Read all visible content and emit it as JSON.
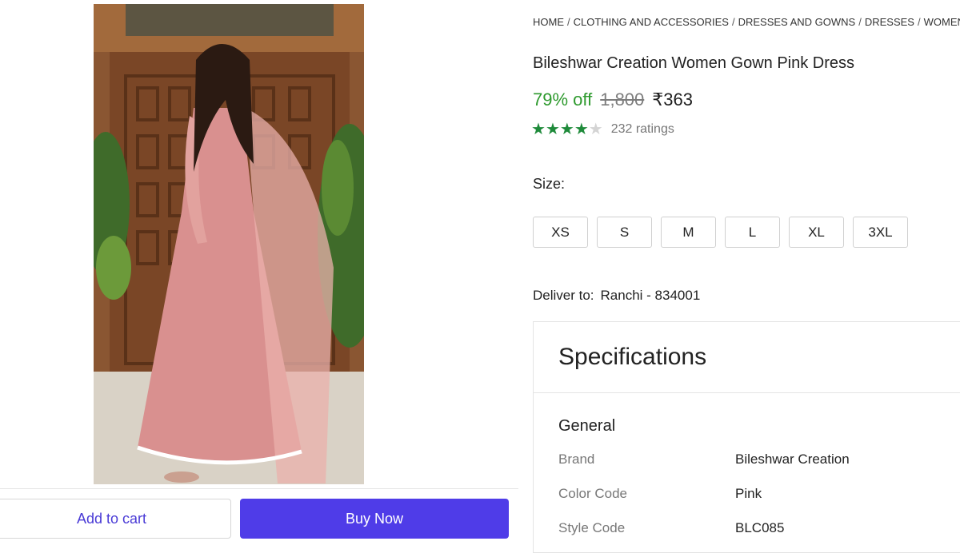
{
  "breadcrumb": [
    "HOME",
    "CLOTHING AND ACCESSORIES",
    "DRESSES AND GOWNS",
    "DRESSES",
    "WOMEN'S DR"
  ],
  "product": {
    "title": "Bileshwar Creation Women Gown Pink Dress",
    "discount": "79% off",
    "mrp": "1,800",
    "price": "₹363",
    "rating_value": 4,
    "rating_max": 5,
    "ratings_text": "232 ratings"
  },
  "size": {
    "label": "Size:",
    "options": [
      "XS",
      "S",
      "M",
      "L",
      "XL",
      "3XL"
    ]
  },
  "delivery": {
    "label": "Deliver to:",
    "location": "Ranchi - 834001"
  },
  "specifications": {
    "title": "Specifications",
    "section": "General",
    "rows": [
      {
        "key": "Brand",
        "value": "Bileshwar Creation"
      },
      {
        "key": "Color Code",
        "value": "Pink"
      },
      {
        "key": "Style Code",
        "value": "BLC085"
      }
    ]
  },
  "actions": {
    "add_to_cart": "Add to cart",
    "buy_now": "Buy Now"
  },
  "colors": {
    "discount": "#2e9a2e",
    "accent": "#4f3ce8",
    "star": "#1e8a3a"
  },
  "icons": [
    "star-icon"
  ]
}
